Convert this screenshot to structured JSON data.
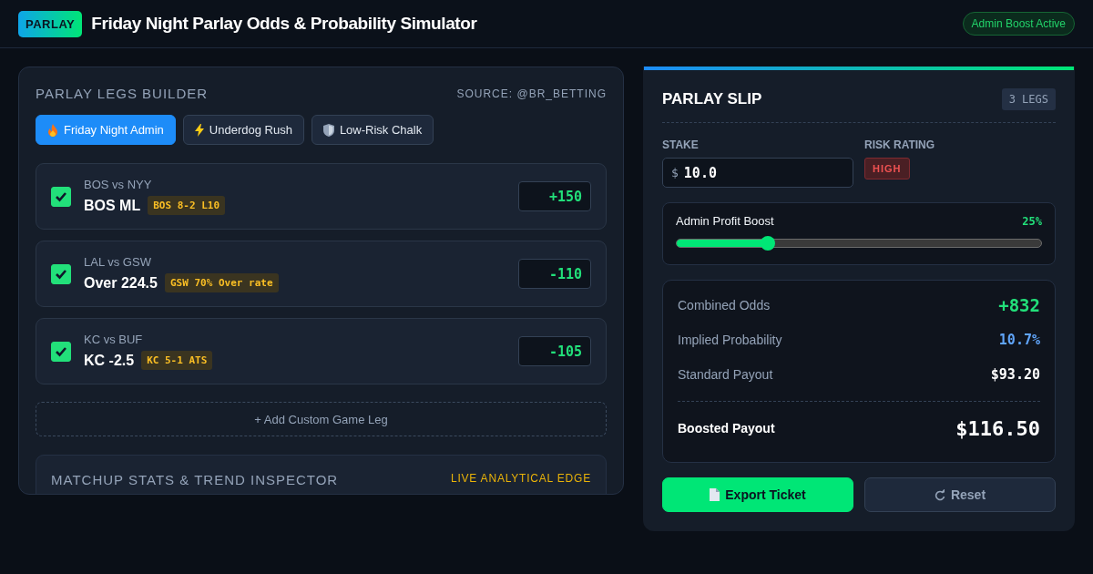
{
  "header": {
    "logo": "PARLAY",
    "title": "Friday Night Parlay Odds & Probability Simulator",
    "status_badge": "Admin Boost Active"
  },
  "builder": {
    "title": "PARLAY LEGS BUILDER",
    "source": "SOURCE: @BR_BETTING",
    "presets": [
      {
        "kind": "admin",
        "label": "Friday Night Admin",
        "selected": true
      },
      {
        "kind": "underdog",
        "label": "Underdog Rush",
        "selected": false
      },
      {
        "kind": "chalk",
        "label": "Low-Risk Chalk",
        "selected": false
      }
    ],
    "legs": [
      {
        "matchup": "BOS vs NYY",
        "pick": "BOS ML",
        "trend": "BOS 8-2 L10",
        "odds": "+150",
        "checked": true
      },
      {
        "matchup": "LAL vs GSW",
        "pick": "Over 224.5",
        "trend": "GSW 70% Over rate",
        "odds": "-110",
        "checked": true
      },
      {
        "matchup": "KC vs BUF",
        "pick": "KC -2.5",
        "trend": "KC 5-1 ATS",
        "odds": "-105",
        "checked": true
      }
    ],
    "add_leg": "+ Add Custom Game Leg"
  },
  "inspector": {
    "title": "MATCHUP STATS & TREND INSPECTOR",
    "tag": "LIVE ANALYTICAL EDGE"
  },
  "slip": {
    "title": "PARLAY SLIP",
    "legs_count": "3 LEGS",
    "stake_label": "STAKE",
    "currency": "$",
    "stake": "10.0",
    "risk_label": "RISK RATING",
    "risk": "HIGH",
    "boost": {
      "label": "Admin Profit Boost",
      "reading": "25%",
      "level": 0.25
    },
    "results": [
      {
        "label": "Combined Odds",
        "value": "+832",
        "kind": "odds"
      },
      {
        "label": "Implied Probability",
        "value": "10.7%",
        "kind": "probability"
      },
      {
        "label": "Standard Payout",
        "value": "$93.20",
        "kind": "payout"
      },
      {
        "label": "Boosted Payout",
        "value": "$116.50",
        "kind": "total"
      }
    ],
    "buttons": [
      {
        "label": "Export Ticket",
        "kind": "primary"
      },
      {
        "label": "Reset",
        "kind": "secondary"
      }
    ]
  }
}
